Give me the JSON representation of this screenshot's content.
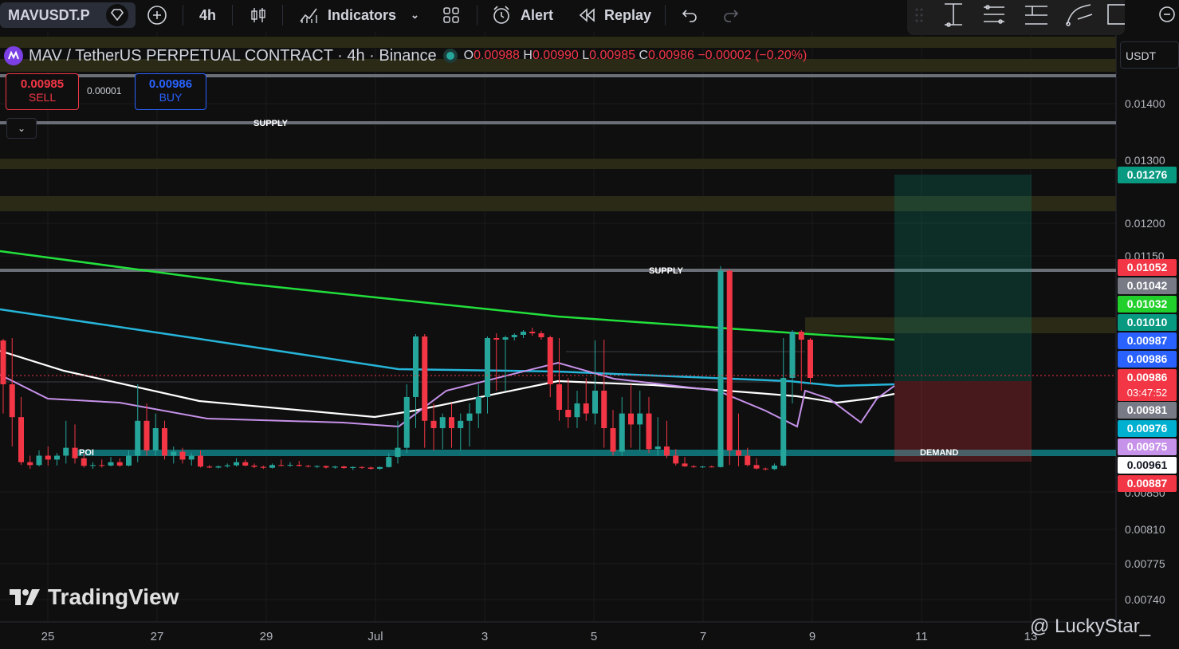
{
  "toolbar": {
    "symbol": "MAVUSDT.P",
    "interval": "4h",
    "indicators_label": "Indicators",
    "alert_label": "Alert",
    "replay_label": "Replay"
  },
  "legend": {
    "title": "MAV / TetherUS PERPETUAL CONTRACT · 4h · Binance",
    "o_key": "O",
    "o": "0.00988",
    "h_key": "H",
    "h": "0.00990",
    "l_key": "L",
    "l": "0.00985",
    "c_key": "C",
    "c": "0.00986",
    "change": "−0.00002 (−0.20%)"
  },
  "trade": {
    "sell_price": "0.00985",
    "sell_label": "SELL",
    "spread": "0.00001",
    "buy_price": "0.00986",
    "buy_label": "BUY"
  },
  "currency": "USDT",
  "watermark": "TradingView",
  "credit": "@ LuckyStar_",
  "colors": {
    "up": "#26a69a",
    "down": "#f23645",
    "ema_green": "#22e03c",
    "ema_blue": "#26b4d8",
    "ema_white": "#ffffff",
    "ema_violet": "#c792ea"
  },
  "chart_data": {
    "type": "candlestick",
    "y_axis_ticks": [
      "0.01400",
      "0.01300",
      "0.01200",
      "0.01150",
      "0.00850",
      "0.00810",
      "0.00775",
      "0.00740"
    ],
    "x_axis_ticks": [
      "25",
      "27",
      "29",
      "Jul",
      "3",
      "5",
      "7",
      "9",
      "11",
      "13"
    ],
    "zone_labels": [
      "SUPPLY",
      "SUPPLY",
      "POI",
      "DEMAND"
    ],
    "price_tags": [
      {
        "label": "0.01276",
        "color": "#089981"
      },
      {
        "label": "0.01052",
        "color": "#f23645"
      },
      {
        "label": "0.01042",
        "color": "#787b86"
      },
      {
        "label": "0.01032",
        "color": "#22d02c"
      },
      {
        "label": "0.01010",
        "color": "#089981"
      },
      {
        "label": "0.00987",
        "color": "#2962ff"
      },
      {
        "label": "0.00986",
        "color": "#2962ff"
      },
      {
        "label": "0.00986",
        "sub": "03:47:52",
        "color": "#f23645"
      },
      {
        "label": "0.00981",
        "color": "#787b86"
      },
      {
        "label": "0.00976",
        "color": "#00b0d0"
      },
      {
        "label": "0.00975",
        "color": "#c792ea"
      },
      {
        "label": "0.00961",
        "color": "#ffffff"
      },
      {
        "label": "0.00887",
        "color": "#f23645"
      }
    ],
    "position": {
      "target": 0.01276,
      "entry": 0.00986,
      "stop": 0.00887
    },
    "candles": [
      [
        0.00987,
        0.00989,
        0.0098,
        0.00985
      ],
      [
        0.00985,
        0.0099,
        0.00975,
        0.00979
      ],
      [
        0.00979,
        0.00983,
        0.00961,
        0.00963
      ],
      [
        0.00963,
        0.00968,
        0.00945,
        0.0096
      ],
      [
        0.0096,
        0.00972,
        0.00955,
        0.00968
      ],
      [
        0.00968,
        0.00975,
        0.00958,
        0.00965
      ],
      [
        0.00965,
        0.0097,
        0.00958,
        0.00968
      ],
      [
        0.00968,
        0.00978,
        0.00962,
        0.00974
      ],
      [
        0.00974,
        0.00977,
        0.00962,
        0.00966
      ],
      [
        0.00966,
        0.0097,
        0.0095,
        0.00957
      ],
      [
        0.00957,
        0.00963,
        0.00945,
        0.0096
      ],
      [
        0.0096,
        0.00965,
        0.0095,
        0.00958
      ],
      [
        0.00958,
        0.00967,
        0.00955,
        0.00963
      ],
      [
        0.00963,
        0.00966,
        0.00953,
        0.00958
      ],
      [
        0.00958,
        0.00972,
        0.00955,
        0.00968
      ],
      [
        0.00968,
        0.00985,
        0.00963,
        0.00978
      ],
      [
        0.00978,
        0.00982,
        0.00968,
        0.00972
      ],
      [
        0.00972,
        0.0098,
        0.00968,
        0.00976
      ],
      [
        0.00976,
        0.00978,
        0.00965,
        0.00968
      ],
      [
        0.00968,
        0.00975,
        0.00962,
        0.00971
      ],
      [
        0.00971,
        0.00974,
        0.00962,
        0.00965
      ],
      [
        0.00965,
        0.0097,
        0.00958,
        0.00968
      ],
      [
        0.00968,
        0.00972,
        0.0095,
        0.00954
      ],
      [
        0.00954,
        0.0096,
        0.00948,
        0.0095
      ],
      [
        0.0095,
        0.00958,
        0.00946,
        0.00955
      ],
      [
        0.00955,
        0.00962,
        0.0095,
        0.00959
      ],
      [
        0.00959,
        0.00966,
        0.00954,
        0.00963
      ],
      [
        0.00963,
        0.00965,
        0.00955,
        0.00958
      ],
      [
        0.00958,
        0.00962,
        0.00948,
        0.00953
      ],
      [
        0.00953,
        0.00958,
        0.00944,
        0.00949
      ],
      [
        0.00949,
        0.00962,
        0.00946,
        0.0096
      ],
      [
        0.0096,
        0.00965,
        0.00955,
        0.00958
      ],
      [
        0.00958,
        0.00963,
        0.00953,
        0.00961
      ],
      [
        0.00961,
        0.00964,
        0.00954,
        0.00957
      ],
      [
        0.00957,
        0.0096,
        0.0095,
        0.00955
      ],
      [
        0.00955,
        0.00959,
        0.00948,
        0.00956
      ],
      [
        0.00956,
        0.00958,
        0.00946,
        0.0095
      ],
      [
        0.0095,
        0.00957,
        0.00945,
        0.00954
      ],
      [
        0.00954,
        0.00958,
        0.00945,
        0.00948
      ],
      [
        0.00948,
        0.00955,
        0.0094,
        0.00952
      ],
      [
        0.00952,
        0.00955,
        0.00945,
        0.0095
      ],
      [
        0.0095,
        0.00954,
        0.00942,
        0.00945
      ],
      [
        0.00945,
        0.00954,
        0.0094,
        0.00952
      ],
      [
        0.00952,
        0.0097,
        0.0095,
        0.00967
      ],
      [
        0.00967,
        0.00978,
        0.00962,
        0.00974
      ],
      [
        0.00974,
        0.00985,
        0.0097,
        0.00983
      ],
      [
        0.00983,
        0.00995,
        0.00976,
        0.00992
      ],
      [
        0.00992,
        0.00995,
        0.00974,
        0.00978
      ],
      [
        0.00978,
        0.00982,
        0.00972,
        0.00976
      ],
      [
        0.00976,
        0.0098,
        0.00973,
        0.00979
      ],
      [
        0.00979,
        0.00982,
        0.00974,
        0.00976
      ],
      [
        0.00976,
        0.0098,
        0.00972,
        0.00978
      ],
      [
        0.00978,
        0.00982,
        0.00975,
        0.0098
      ],
      [
        0.0098,
        0.00985,
        0.00976,
        0.00983
      ],
      [
        0.00983,
        0.00992,
        0.0098,
        0.0099
      ],
      [
        0.0099,
        0.00996,
        0.00984,
        0.00988
      ],
      [
        0.00988,
        0.00993,
        0.00984,
        0.00991
      ],
      [
        0.00991,
        0.00996,
        0.00987,
        0.00994
      ],
      [
        0.00994,
        0.01,
        0.0099,
        0.00998
      ],
      [
        0.00998,
        0.01003,
        0.00993,
        0.00996
      ],
      [
        0.00996,
        0.00999,
        0.00988,
        0.00991
      ],
      [
        0.00991,
        0.00993,
        0.00983,
        0.00985
      ],
      [
        0.00985,
        0.0099,
        0.00978,
        0.00981
      ],
      [
        0.00981,
        0.00986,
        0.00976,
        0.00979
      ],
      [
        0.00979,
        0.00984,
        0.00976,
        0.00982
      ],
      [
        0.00982,
        0.00986,
        0.00978,
        0.0098
      ],
      [
        0.0098,
        0.00987,
        0.00977,
        0.00984
      ],
      [
        0.00984,
        0.00988,
        0.00974,
        0.00976
      ],
      [
        0.00976,
        0.00981,
        0.00968,
        0.00971
      ],
      [
        0.00971,
        0.00983,
        0.00968,
        0.0098
      ],
      [
        0.0098,
        0.00985,
        0.00974,
        0.00977
      ],
      [
        0.00977,
        0.00984,
        0.00972,
        0.0098
      ],
      [
        0.0098,
        0.00983,
        0.0097,
        0.00973
      ],
      [
        0.00973,
        0.00979,
        0.00968,
        0.00975
      ],
      [
        0.00975,
        0.00978,
        0.00966,
        0.00968
      ],
      [
        0.00968,
        0.00973,
        0.00958,
        0.00962
      ],
      [
        0.00962,
        0.00967,
        0.00952,
        0.00955
      ],
      [
        0.00955,
        0.0096,
        0.00948,
        0.00952
      ],
      [
        0.00952,
        0.00957,
        0.00948,
        0.00954
      ],
      [
        0.00954,
        0.00958,
        0.0095,
        0.00952
      ],
      [
        0.00952,
        0.0106,
        0.0095,
        0.0105
      ],
      [
        0.0105,
        0.01051,
        0.0096,
        0.00972
      ],
      [
        0.00972,
        0.0098,
        0.00955,
        0.00968
      ],
      [
        0.00968,
        0.00974,
        0.00955,
        0.0096
      ],
      [
        0.0096,
        0.00966,
        0.00942,
        0.00946
      ],
      [
        0.00946,
        0.0095,
        0.00938,
        0.00944
      ],
      [
        0.00944,
        0.00962,
        0.0094,
        0.00958
      ],
      [
        0.00958,
        0.0099,
        0.00954,
        0.00986
      ],
      [
        0.00986,
        0.01,
        0.00982,
        0.00998
      ],
      [
        0.00998,
        0.01,
        0.00984,
        0.00988
      ],
      [
        0.00988,
        0.0099,
        0.00985,
        0.00986
      ]
    ],
    "ema_series": [
      {
        "color": "#22e03c",
        "values": [
          0.01163,
          0.01075,
          0.01039,
          0.01032
        ]
      },
      {
        "color": "#26b4d8",
        "values": [
          0.01061,
          0.01022,
          0.0099,
          0.00991,
          0.00981,
          0.00976
        ]
      },
      {
        "color": "#ffffff",
        "values": [
          0.01,
          0.0099,
          0.00962,
          0.00955,
          0.00984,
          0.00966,
          0.00961
        ]
      }
    ]
  }
}
